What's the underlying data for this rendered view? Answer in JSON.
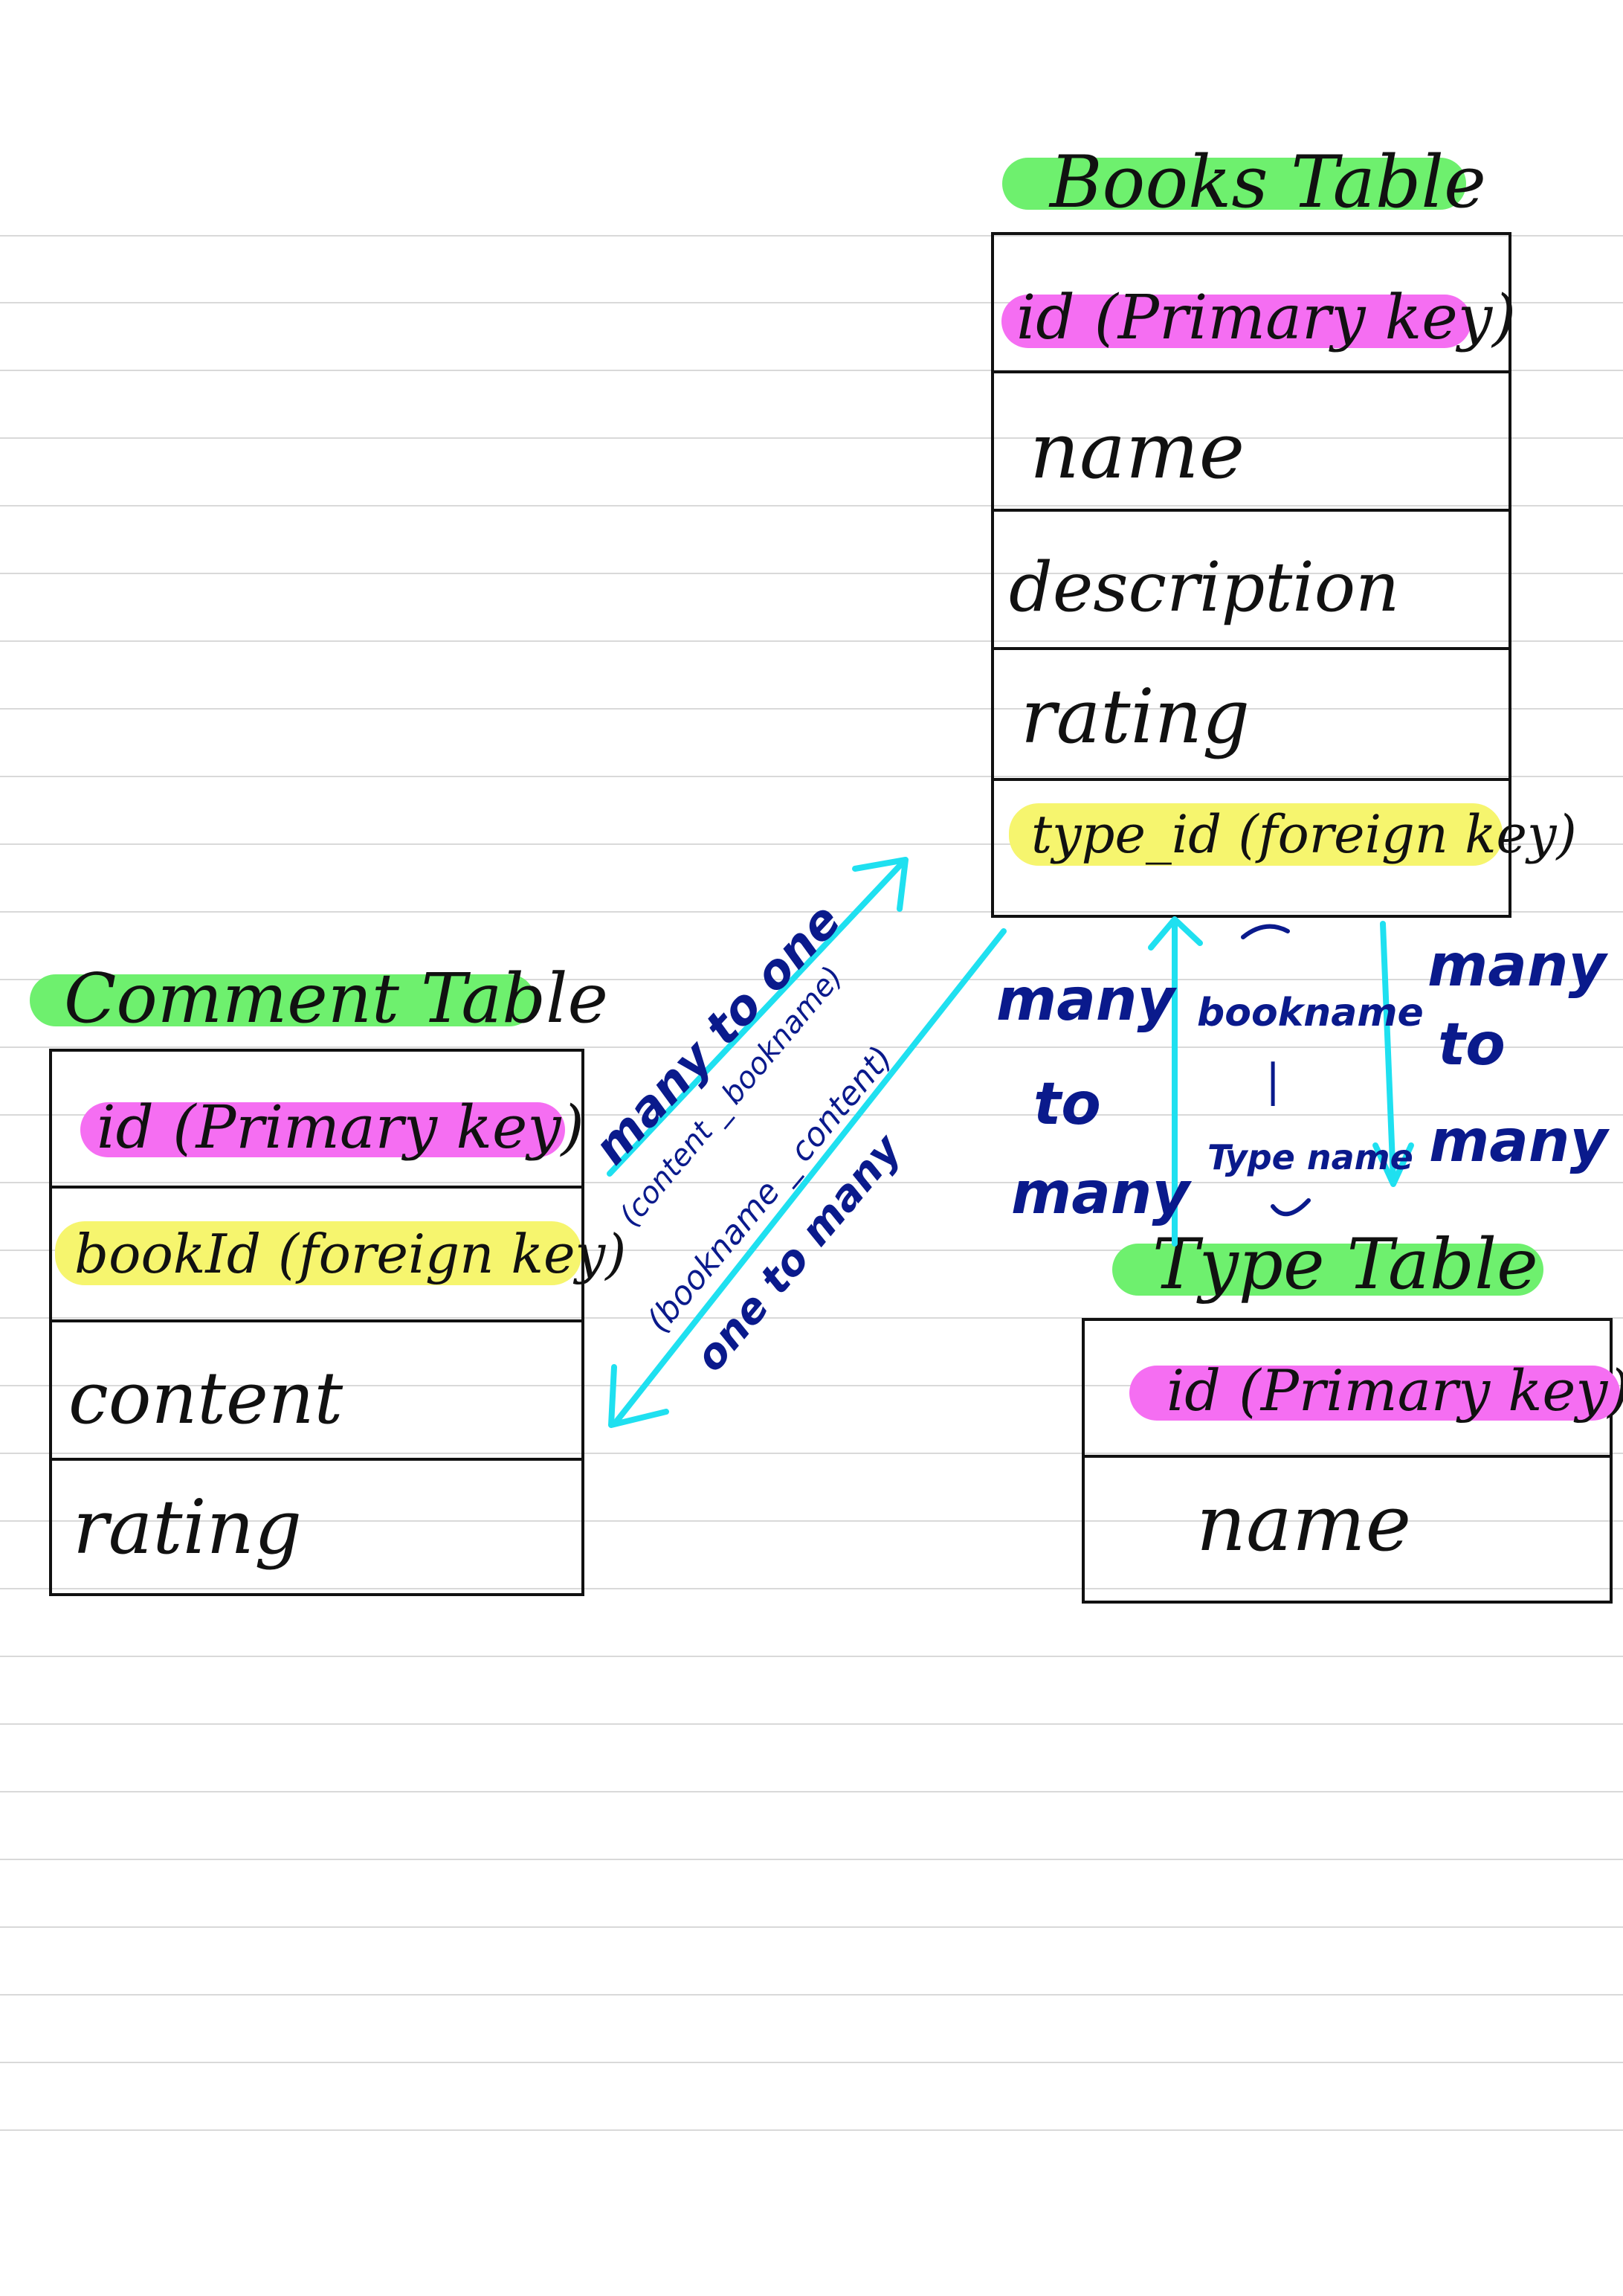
{
  "books_table": {
    "title": "Books Table",
    "rows": [
      {
        "label": "id (Primary key)",
        "highlight": "primary-key"
      },
      {
        "label": "name",
        "highlight": "none"
      },
      {
        "label": "description",
        "highlight": "none"
      },
      {
        "label": "rating",
        "highlight": "none"
      },
      {
        "label": "type_id (foreign key)",
        "highlight": "foreign-key"
      }
    ]
  },
  "comment_table": {
    "title": "Comment Table",
    "rows": [
      {
        "label": "id (Primary key)",
        "highlight": "primary-key"
      },
      {
        "label": "bookId (foreign key)",
        "highlight": "foreign-key"
      },
      {
        "label": "content",
        "highlight": "none"
      },
      {
        "label": "rating",
        "highlight": "none"
      }
    ]
  },
  "type_table": {
    "title": "Type Table",
    "rows": [
      {
        "label": "id (Primary key)",
        "highlight": "primary-key"
      },
      {
        "label": "name",
        "highlight": "none"
      }
    ]
  },
  "relations": {
    "comment_to_book": {
      "cardinality": "many to one",
      "mapping": "(content _ bookname)"
    },
    "book_to_comment": {
      "mapping": "(bookname _ content)",
      "cardinality": "one to many"
    },
    "type_to_book": {
      "cardinality_line1": "many",
      "cardinality_line2": "to",
      "cardinality_line3": "many"
    },
    "book_type_mapping": {
      "top": "bookname",
      "separator": "|",
      "bottom": "Type name"
    },
    "book_to_type": {
      "cardinality_line1": "many",
      "cardinality_line2": "to",
      "cardinality_line3": "many"
    }
  },
  "colors": {
    "title_highlight": "#6ef06e",
    "primary_key_highlight": "#f56ef2",
    "foreign_key_highlight": "#f6f56e",
    "arrow": "#1fe0f0",
    "annotation_ink": "#0a1a8c"
  }
}
